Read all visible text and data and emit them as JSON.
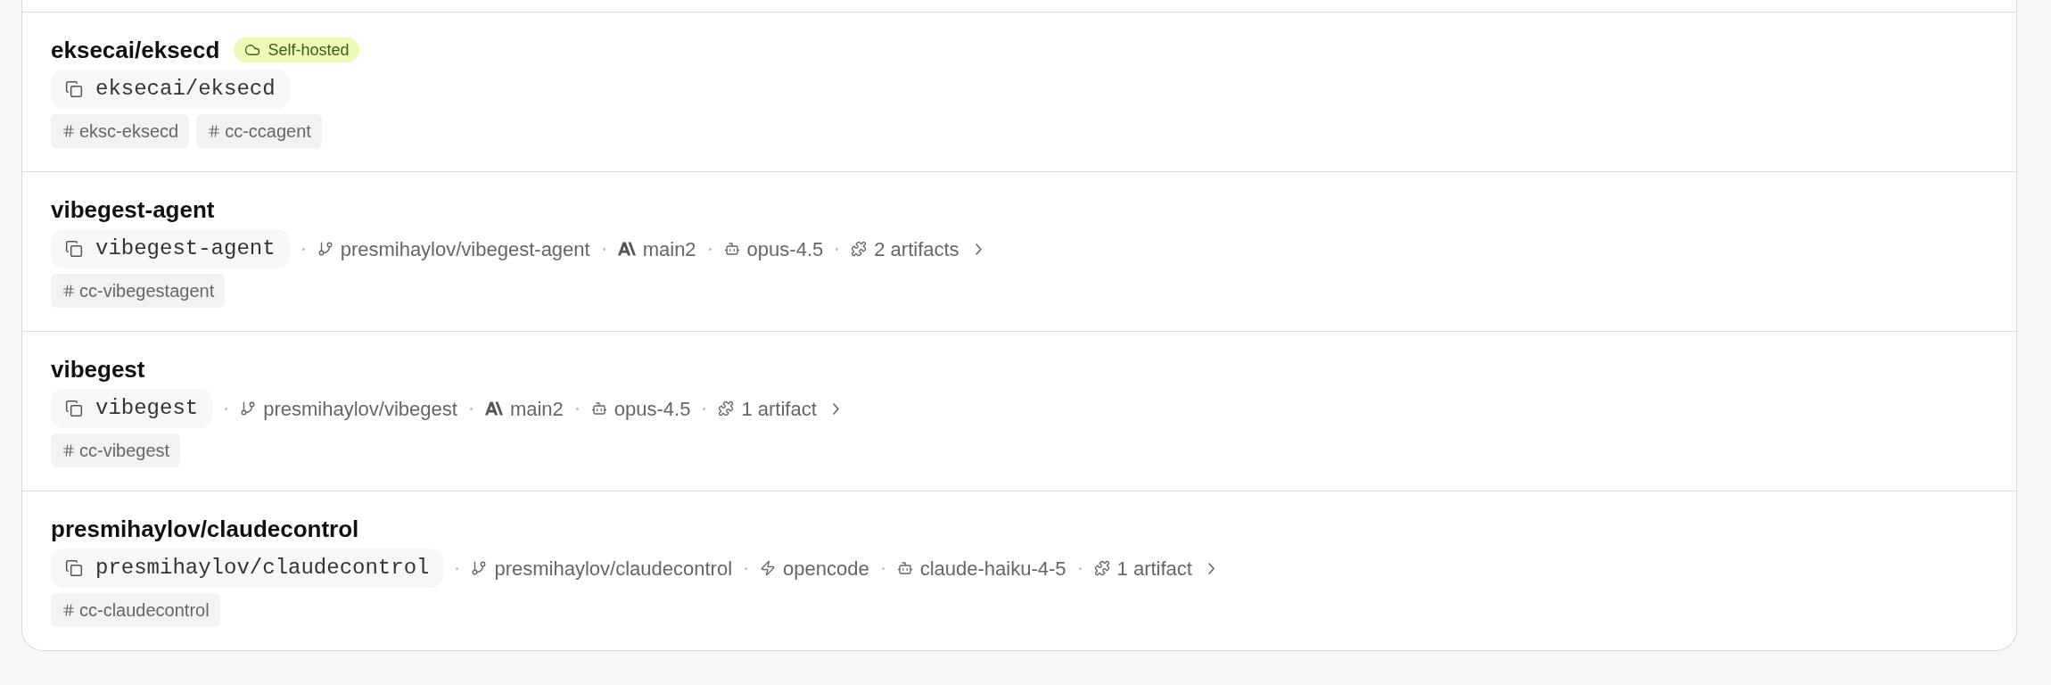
{
  "projects": [
    {
      "title": "eksecai/eksecd",
      "badge": {
        "label": "Self-hosted"
      },
      "copy": "eksecai/eksecd",
      "tags": [
        "eksc-eksecd",
        "cc-ccagent"
      ]
    },
    {
      "title": "vibegest-agent",
      "copy": "vibegest-agent",
      "meta": [
        {
          "kind": "repo",
          "text": "presmihaylov/vibegest-agent"
        },
        {
          "kind": "claude",
          "text": "main2"
        },
        {
          "kind": "model",
          "text": "opus-4.5"
        },
        {
          "kind": "artifacts",
          "text": "2 artifacts"
        }
      ],
      "tags": [
        "cc-vibegestagent"
      ]
    },
    {
      "title": "vibegest",
      "copy": "vibegest",
      "meta": [
        {
          "kind": "repo",
          "text": "presmihaylov/vibegest"
        },
        {
          "kind": "claude",
          "text": "main2"
        },
        {
          "kind": "model",
          "text": "opus-4.5"
        },
        {
          "kind": "artifacts",
          "text": "1 artifact"
        }
      ],
      "tags": [
        "cc-vibegest"
      ]
    },
    {
      "title": "presmihaylov/claudecontrol",
      "copy": "presmihaylov/claudecontrol",
      "meta": [
        {
          "kind": "repo",
          "text": "presmihaylov/claudecontrol"
        },
        {
          "kind": "opencode",
          "text": "opencode"
        },
        {
          "kind": "model",
          "text": "claude-haiku-4-5"
        },
        {
          "kind": "artifacts",
          "text": "1 artifact"
        }
      ],
      "tags": [
        "cc-claudecontrol"
      ]
    }
  ]
}
